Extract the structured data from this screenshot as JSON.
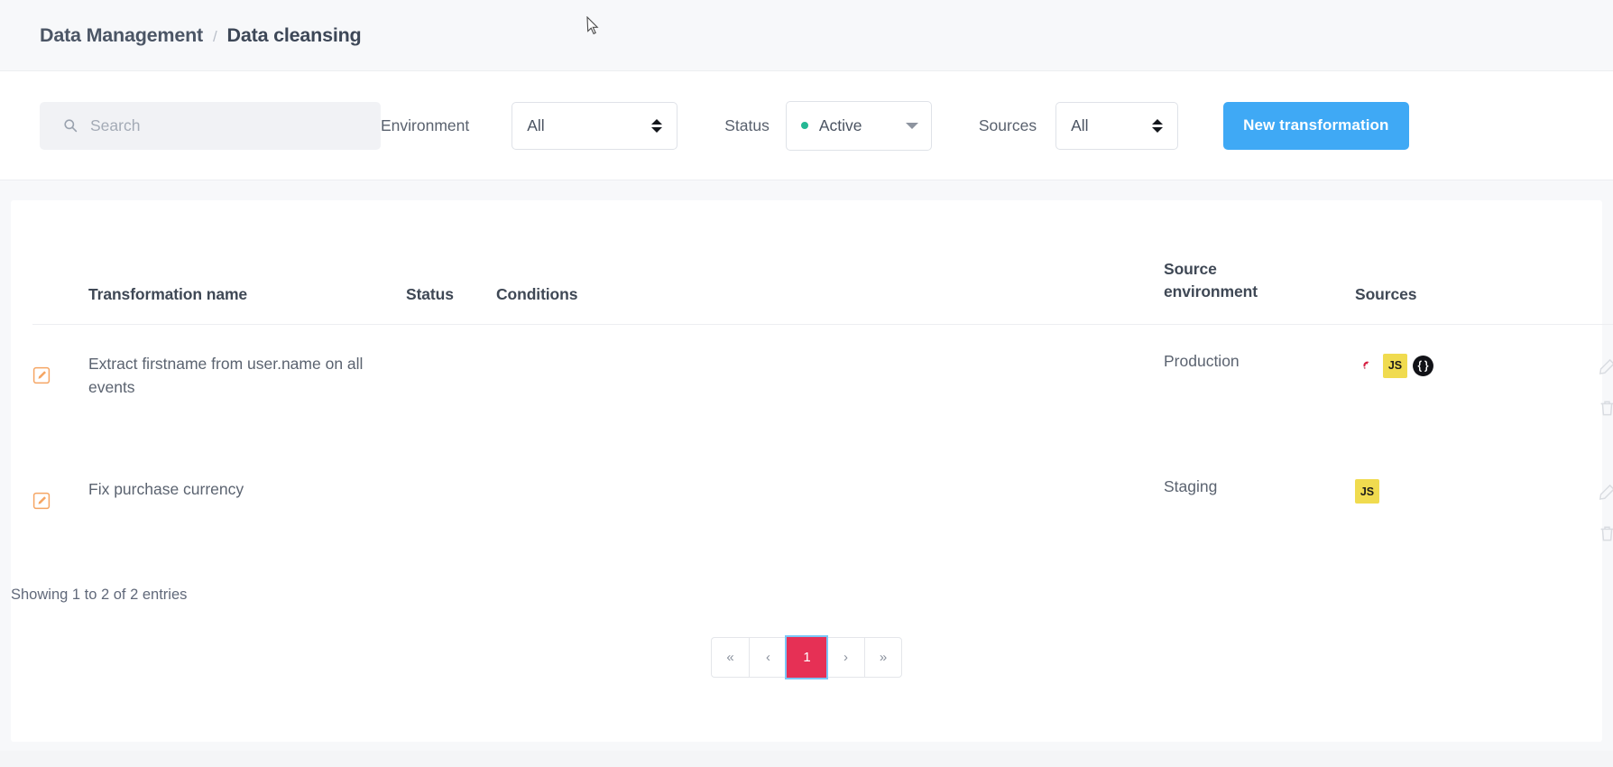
{
  "breadcrumb": {
    "parent": "Data Management",
    "separator": "/",
    "current": "Data cleansing"
  },
  "toolbar": {
    "search": {
      "placeholder": "Search",
      "value": "",
      "icon": "search-icon"
    },
    "environment": {
      "label": "Environment",
      "value": "All",
      "icon": "updown-arrows-icon"
    },
    "status": {
      "label": "Status",
      "value": "Active",
      "dot_color": "#24b894",
      "icon": "chevron-down-icon"
    },
    "sources": {
      "label": "Sources",
      "value": "All",
      "icon": "updown-arrows-icon"
    },
    "new_button": {
      "label": "New transformation",
      "color": "#3fa9f5"
    }
  },
  "table": {
    "headers": {
      "icon": "",
      "name": "Transformation name",
      "status": "Status",
      "conditions": "Conditions",
      "environment_line1": "Source",
      "environment_line2": "environment",
      "sources": "Sources",
      "actions": ""
    },
    "rows": [
      {
        "edit_badge_icon": "edit-square-icon",
        "name": "Extract firstname from user.name on all events",
        "status_dot_color": "#20b08c",
        "conditions": "",
        "environment": "Production",
        "sources": [
          {
            "name": "ruby-icon",
            "label": "",
            "kind": "ruby"
          },
          {
            "name": "javascript-icon",
            "label": "JS",
            "kind": "js"
          },
          {
            "name": "json-api-icon",
            "label": "{ }",
            "kind": "json"
          }
        ],
        "actions": [
          {
            "name": "edit-pencil-icon"
          },
          {
            "name": "delete-trash-icon"
          }
        ]
      },
      {
        "edit_badge_icon": "edit-square-icon",
        "name": "Fix purchase currency",
        "status_dot_color": "#20b08c",
        "conditions": "",
        "environment": "Staging",
        "sources": [
          {
            "name": "javascript-icon",
            "label": "JS",
            "kind": "js"
          }
        ],
        "actions": [
          {
            "name": "edit-pencil-icon"
          },
          {
            "name": "delete-trash-icon"
          }
        ]
      }
    ]
  },
  "footer": {
    "showing": "Showing 1 to 2 of 2 entries",
    "pagination": {
      "first": "«",
      "prev": "‹",
      "pages": [
        "1"
      ],
      "next": "›",
      "last": "»",
      "active_page": "1",
      "active_color": "#e63055"
    }
  }
}
